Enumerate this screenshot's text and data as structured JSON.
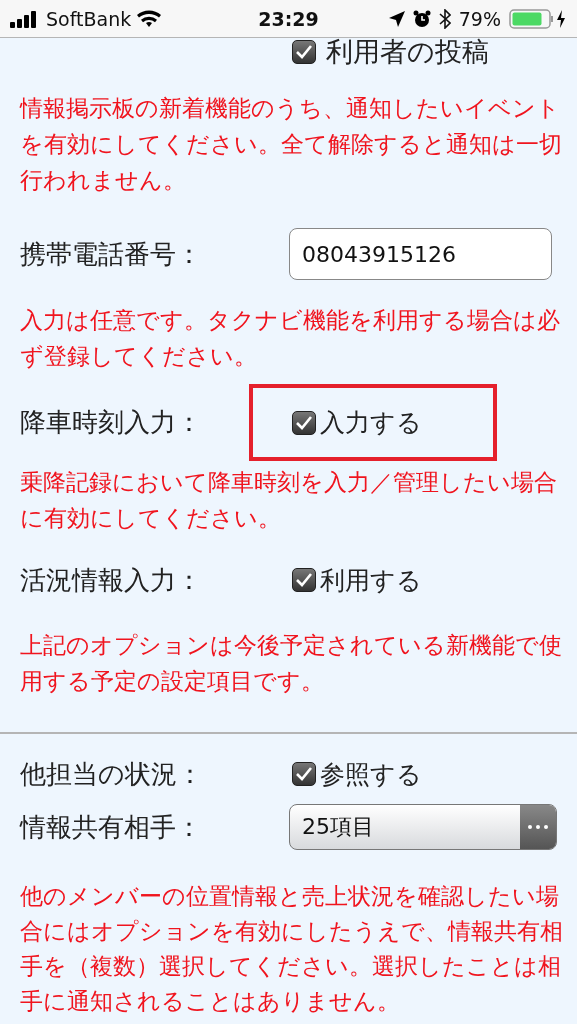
{
  "status_bar": {
    "carrier": "SoftBank",
    "time": "23:29",
    "battery": "79%"
  },
  "items": [
    {
      "kind": "checkbox",
      "option": "利用者の投稿",
      "checked": true,
      "highlighted": false
    },
    {
      "kind": "note",
      "text": "情報掲示板の新着機能のうち、通知したいイベントを有効にしてください。全て解除すると通知は一切行われません。"
    },
    {
      "kind": "input",
      "label": "携帯電話番号：",
      "value": "08043915126"
    },
    {
      "kind": "note",
      "text": "入力は任意です。タクナビ機能を利用する場合は必ず登録してください。"
    },
    {
      "kind": "checkbox",
      "label": "降車時刻入力：",
      "option": "入力する",
      "checked": true,
      "highlighted": true
    },
    {
      "kind": "note",
      "text": "乗降記録において降車時刻を入力／管理したい場合に有効にしてください。"
    },
    {
      "kind": "checkbox",
      "label": "活況情報入力：",
      "option": "利用する",
      "checked": true,
      "highlighted": false
    },
    {
      "kind": "note",
      "text": "上記のオプションは今後予定されている新機能で使用する予定の設定項目です。"
    },
    {
      "kind": "divider"
    },
    {
      "kind": "checkbox",
      "label": "他担当の状況：",
      "option": "参照する",
      "checked": true,
      "highlighted": false
    },
    {
      "kind": "select",
      "label": "情報共有相手：",
      "value": "25項目"
    },
    {
      "kind": "note",
      "text": "他のメンバーの位置情報と売上状況を確認したい場合にはオプションを有効にしたうえで、情報共有相手を（複数）選択してください。選択したことは相手に通知されることはありません。"
    }
  ]
}
